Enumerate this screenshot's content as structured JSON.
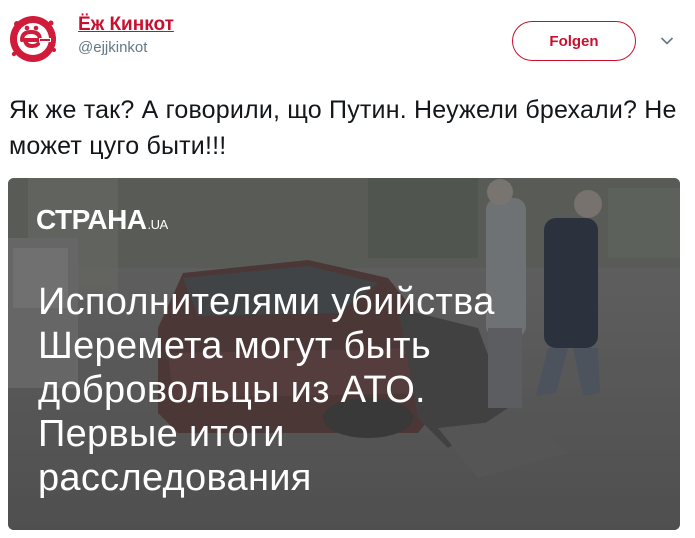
{
  "author": {
    "display_name": "Ёж Кинкот",
    "handle": "@ejjkinkot",
    "avatar_icon": "hedgehog-logo-icon",
    "avatar_color": "#d01c3a"
  },
  "follow_label": "Folgen",
  "menu_icon": "chevron-down-icon",
  "tweet_text": "Як же так? А говорили, що Путин. Неужели брехали? Не может цуго быти!!!",
  "media": {
    "logo_main": "СТРАНА",
    "logo_tld": ".UA",
    "headline_lines": [
      "Исполнителями убийства",
      "Шеремета могут быть",
      "добровольцы из АТО.",
      "Первые итоги",
      "расследования"
    ]
  },
  "colors": {
    "accent": "#c8102e",
    "text": "#14171a",
    "secondary": "#657786"
  }
}
